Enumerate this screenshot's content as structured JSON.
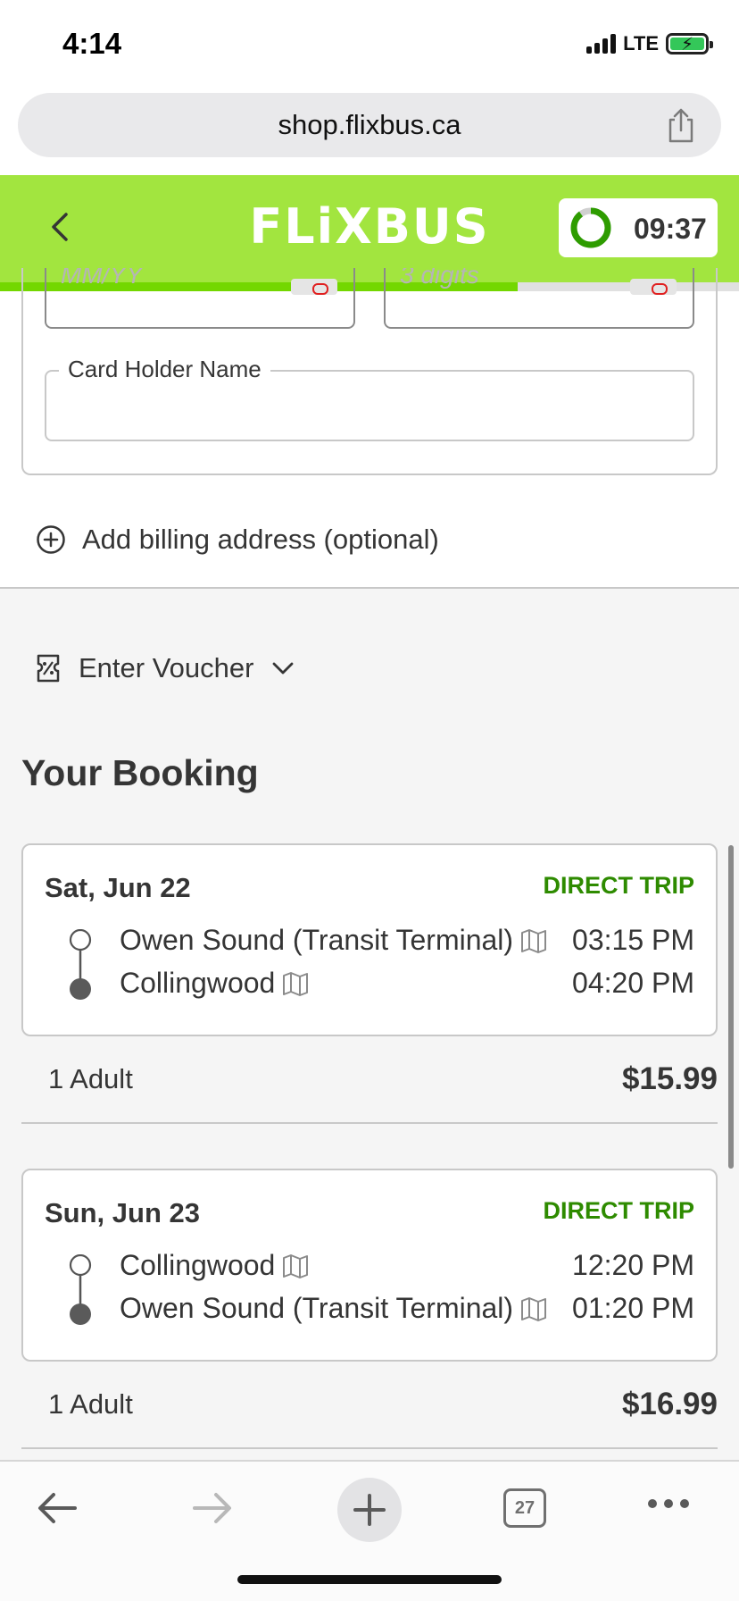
{
  "status": {
    "time": "4:14",
    "network": "LTE"
  },
  "browser": {
    "url": "shop.flixbus.ca",
    "tab_count": "27"
  },
  "header": {
    "logo": "FLiXBUS",
    "timer": "09:37",
    "progress_percent": 70
  },
  "payment": {
    "expiry_placeholder": "MM/YY",
    "cvv_placeholder": "3 digits",
    "card_holder_label": "Card Holder Name",
    "card_holder_value": "",
    "billing_label": "Add billing address (optional)"
  },
  "voucher": {
    "label": "Enter Voucher"
  },
  "booking": {
    "title": "Your Booking",
    "trips": [
      {
        "date": "Sat, Jun 22",
        "type": "DIRECT TRIP",
        "from": "Owen Sound (Transit Terminal)",
        "from_time": "03:15 PM",
        "to": "Collingwood",
        "to_time": "04:20 PM",
        "passengers": "1 Adult",
        "price": "$15.99"
      },
      {
        "date": "Sun, Jun 23",
        "type": "DIRECT TRIP",
        "from": "Collingwood",
        "from_time": "12:20 PM",
        "to": "Owen Sound (Transit Terminal)",
        "to_time": "01:20 PM",
        "passengers": "1 Adult",
        "price": "$16.99"
      }
    ]
  },
  "colors": {
    "brand_green": "#73d700",
    "header_green": "#a2e53f",
    "trip_type": "#2e8b00"
  }
}
